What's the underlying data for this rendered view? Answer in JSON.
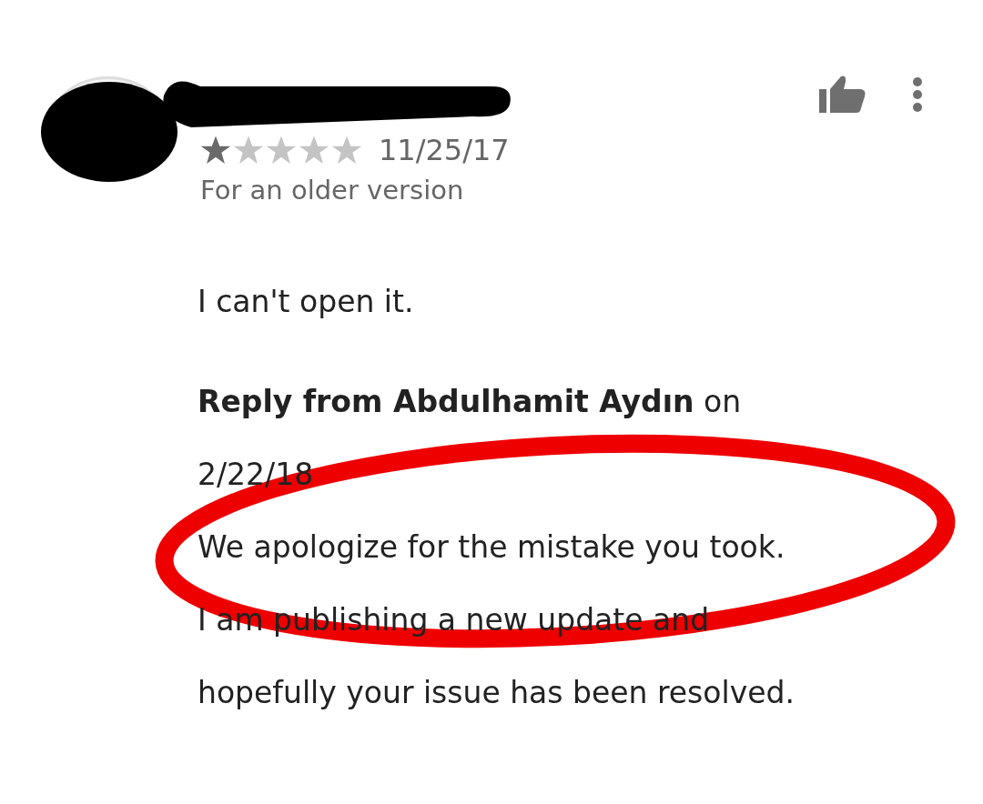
{
  "review": {
    "stars": 1,
    "date": "11/25/17",
    "version_note": "For an older version",
    "text": "I can't open it."
  },
  "reply": {
    "header": "**Reply from Abdulhamit Aydın** on\n2/22/18",
    "text": "We apologize for the mistake you took.\nI am publishing a new update and\nhopefully your issue has been resolved."
  }
}
